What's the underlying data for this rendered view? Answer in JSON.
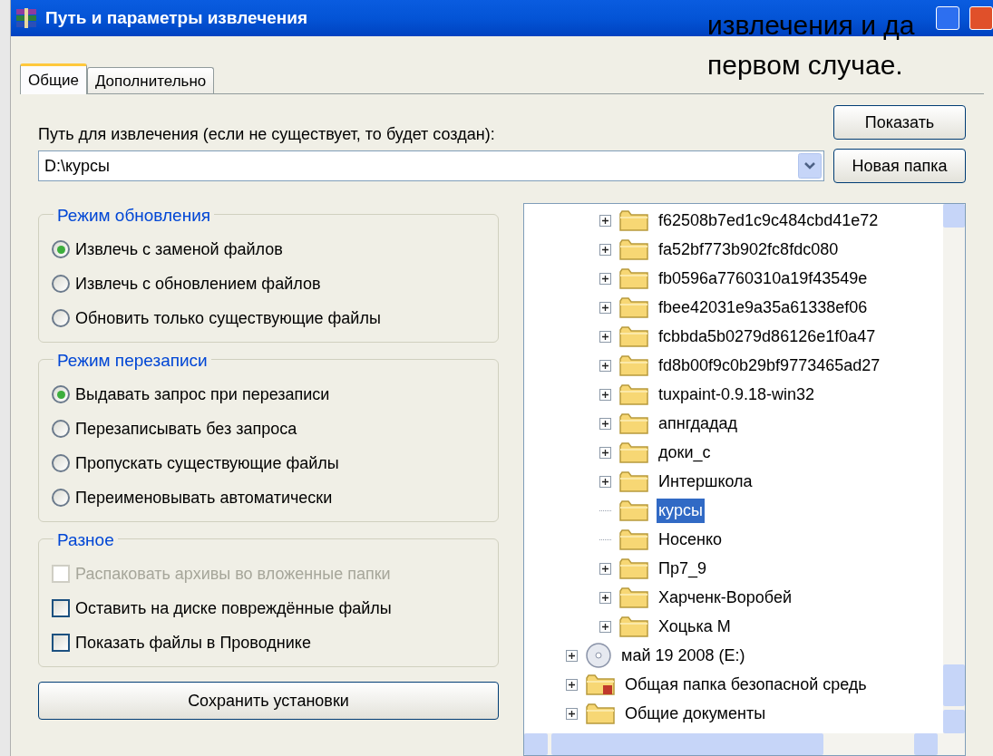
{
  "window": {
    "title": "Путь и параметры извлечения"
  },
  "slide_text": [
    "извлечения и да",
    "первом случае."
  ],
  "tabs": [
    {
      "label": "Общие",
      "selected": true
    },
    {
      "label": "Дополнительно",
      "selected": false
    }
  ],
  "path": {
    "label": "Путь для извлечения (если не существует, то будет создан):",
    "value": "D:\\курсы"
  },
  "side_buttons": [
    "Показать",
    "Новая папка"
  ],
  "groups": [
    {
      "title": "Режим обновления",
      "kind": "radio",
      "options": [
        {
          "label": "Извлечь с заменой файлов",
          "selected": true,
          "disabled": false
        },
        {
          "label": "Извлечь с обновлением файлов",
          "selected": false,
          "disabled": false
        },
        {
          "label": "Обновить только существующие файлы",
          "selected": false,
          "disabled": false
        }
      ]
    },
    {
      "title": "Режим перезаписи",
      "kind": "radio",
      "options": [
        {
          "label": "Выдавать запрос при перезаписи",
          "selected": true,
          "disabled": false
        },
        {
          "label": "Перезаписывать без запроса",
          "selected": false,
          "disabled": false
        },
        {
          "label": "Пропускать существующие файлы",
          "selected": false,
          "disabled": false
        },
        {
          "label": "Переименовывать автоматически",
          "selected": false,
          "disabled": false
        }
      ]
    },
    {
      "title": "Разное",
      "kind": "checkbox",
      "options": [
        {
          "label": "Распаковать архивы во вложенные папки",
          "checked": false,
          "disabled": true
        },
        {
          "label": "Оставить на диске повреждённые файлы",
          "checked": false,
          "disabled": false
        },
        {
          "label": "Показать файлы в Проводнике",
          "checked": false,
          "disabled": false
        }
      ]
    }
  ],
  "save_button": "Сохранить установки",
  "tree": {
    "items": [
      {
        "children": [
          {
            "label": "f62508b7ed1c9c484cbd41e72",
            "kind": "folder",
            "expandable": true,
            "selected": false
          },
          {
            "label": "fa52bf773b902fc8fdc080",
            "kind": "folder",
            "expandable": true,
            "selected": false
          },
          {
            "label": "fb0596a7760310a19f43549e",
            "kind": "folder",
            "expandable": true,
            "selected": false
          },
          {
            "label": "fbee42031e9a35a61338ef06",
            "kind": "folder",
            "expandable": true,
            "selected": false
          },
          {
            "label": "fcbbda5b0279d86126e1f0a47",
            "kind": "folder",
            "expandable": true,
            "selected": false
          },
          {
            "label": "fd8b00f9c0b29bf9773465ad27",
            "kind": "folder",
            "expandable": true,
            "selected": false
          },
          {
            "label": "tuxpaint-0.9.18-win32",
            "kind": "folder",
            "expandable": true,
            "selected": false
          },
          {
            "label": "апнгдадад",
            "kind": "folder",
            "expandable": true,
            "selected": false
          },
          {
            "label": "доки_с",
            "kind": "folder",
            "expandable": true,
            "selected": false
          },
          {
            "label": "Интершкола",
            "kind": "folder",
            "expandable": true,
            "selected": false
          },
          {
            "label": "курсы",
            "kind": "folder",
            "expandable": false,
            "selected": true
          },
          {
            "label": "Носенко",
            "kind": "folder",
            "expandable": false,
            "selected": false
          },
          {
            "label": "Пр7_9",
            "kind": "folder",
            "expandable": true,
            "selected": false
          },
          {
            "label": "Харченк-Воробей",
            "kind": "folder",
            "expandable": true,
            "selected": false
          },
          {
            "label": "Хоцька М",
            "kind": "folder",
            "expandable": true,
            "selected": false
          }
        ]
      },
      {
        "label": "май 19 2008 (E:)",
        "kind": "disc",
        "expandable": true,
        "selected": false
      },
      {
        "label": "Общая папка безопасной средь",
        "kind": "shared-folder",
        "expandable": true,
        "selected": false
      },
      {
        "label": "Общие документы",
        "kind": "folder",
        "expandable": true,
        "selected": false
      }
    ]
  }
}
